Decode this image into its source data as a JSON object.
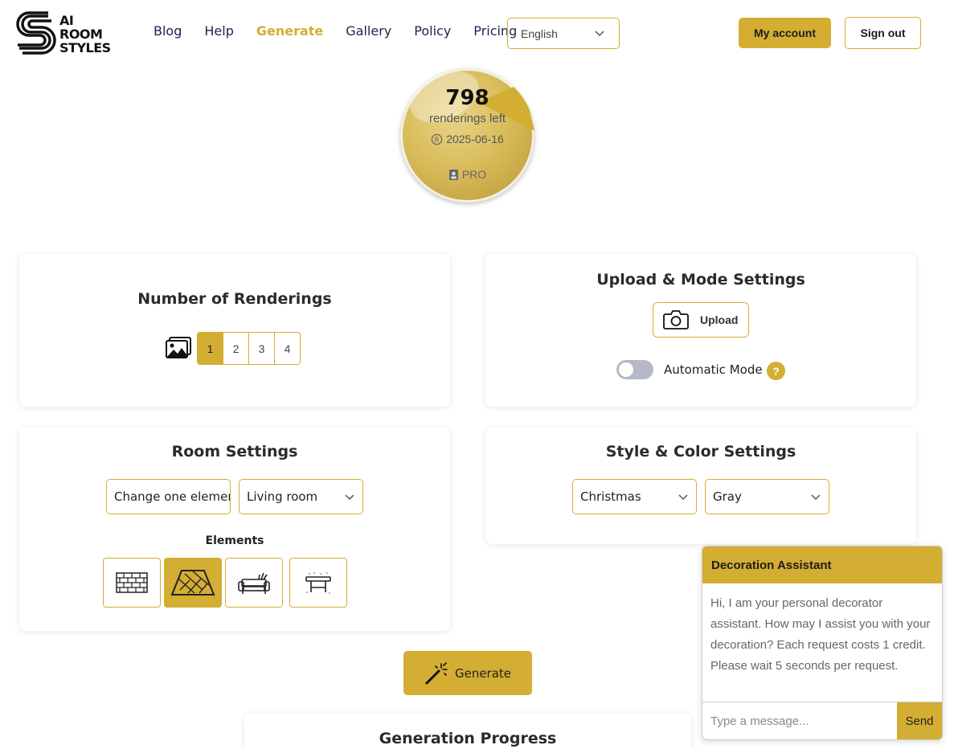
{
  "brand": {
    "logo_lines": [
      "AI",
      "ROOM",
      "STYLES"
    ]
  },
  "nav": {
    "items": [
      {
        "label": "Blog",
        "active": false
      },
      {
        "label": "Help",
        "active": false
      },
      {
        "label": "Generate",
        "active": true
      },
      {
        "label": "Gallery",
        "active": false
      },
      {
        "label": "Policy",
        "active": false
      },
      {
        "label": "Pricing",
        "active": false
      }
    ]
  },
  "language": {
    "selected": "English"
  },
  "header_buttons": {
    "account": "My account",
    "sign_out": "Sign out"
  },
  "credits": {
    "count": "798",
    "label": "renderings left",
    "date": "2025-06-16",
    "plan": "PRO"
  },
  "renderings": {
    "title": "Number of Renderings",
    "options": [
      "1",
      "2",
      "3",
      "4"
    ],
    "selected": "1"
  },
  "upload": {
    "title": "Upload & Mode Settings",
    "button": "Upload",
    "auto_mode_label": "Automatic Mode",
    "auto_mode_on": false,
    "help": "?"
  },
  "room": {
    "title": "Room Settings",
    "mode": "Change one element",
    "room_type": "Living room",
    "elements_label": "Elements",
    "elements": [
      {
        "icon": "brick-wall-icon",
        "selected": false
      },
      {
        "icon": "floor-parquet-icon",
        "selected": true
      },
      {
        "icon": "sofa-icon",
        "selected": false
      },
      {
        "icon": "table-icon",
        "selected": false
      }
    ]
  },
  "style": {
    "title": "Style & Color Settings",
    "style": "Christmas",
    "color": "Gray"
  },
  "generate": {
    "label": "Generate"
  },
  "progress": {
    "title": "Generation Progress"
  },
  "chat": {
    "title": "Decoration Assistant",
    "message": "Hi, I am your personal decorator assistant. How may I assist you with your decoration? Each request costs 1 credit. Please wait 5 seconds per request.",
    "placeholder": "Type a message...",
    "send": "Send"
  },
  "colors": {
    "accent": "#d4ad33",
    "nav_text": "#1f2150"
  }
}
